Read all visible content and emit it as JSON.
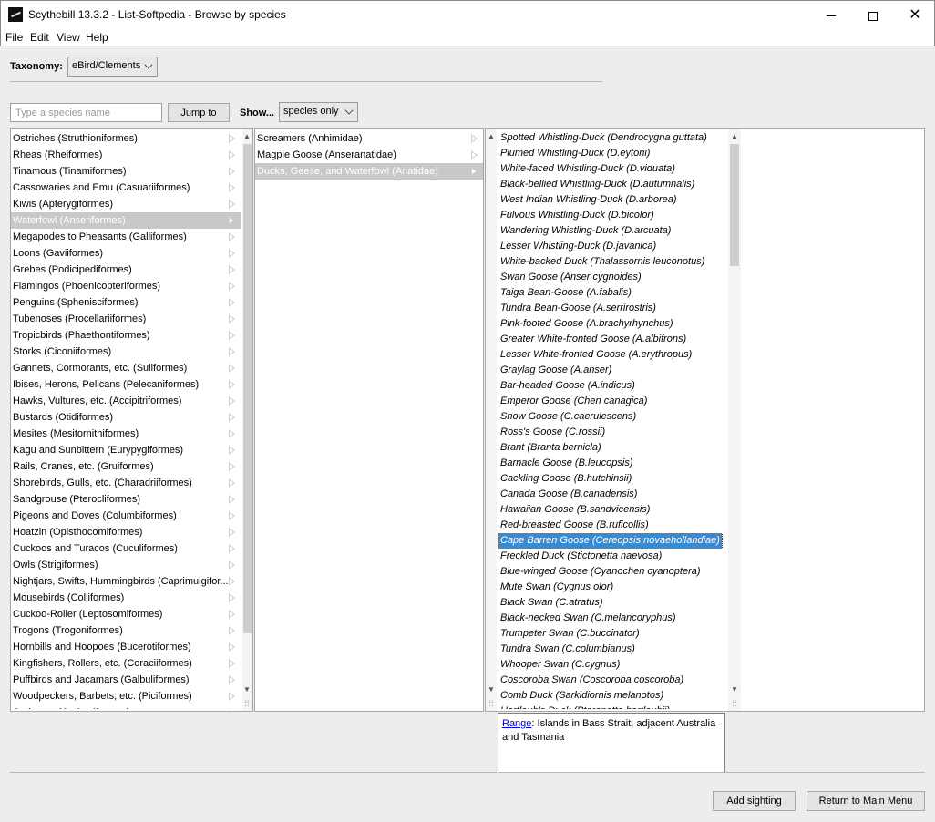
{
  "window": {
    "title": "Scythebill 13.3.2 - List-Softpedia - Browse by species"
  },
  "menu": [
    "File",
    "Edit",
    "View",
    "Help"
  ],
  "taxonomy": {
    "label": "Taxonomy:",
    "value": "eBird/Clements"
  },
  "search": {
    "placeholder": "Type a species name",
    "jump_label": "Jump to"
  },
  "show": {
    "label": "Show...",
    "value": "species only"
  },
  "orders": [
    "Ostriches (Struthioniformes)",
    "Rheas (Rheiformes)",
    "Tinamous (Tinamiformes)",
    "Cassowaries and Emu (Casuariiformes)",
    "Kiwis (Apterygiformes)",
    "Waterfowl (Anseriformes)",
    "Megapodes to Pheasants (Galliformes)",
    "Loons (Gaviiformes)",
    "Grebes (Podicipediformes)",
    "Flamingos (Phoenicopteriformes)",
    "Penguins (Sphenisciformes)",
    "Tubenoses (Procellariiformes)",
    "Tropicbirds (Phaethontiformes)",
    "Storks (Ciconiiformes)",
    "Gannets, Cormorants, etc. (Suliformes)",
    "Ibises, Herons, Pelicans (Pelecaniformes)",
    "Hawks, Vultures, etc. (Accipitriformes)",
    "Bustards (Otidiformes)",
    "Mesites (Mesitornithiformes)",
    "Kagu and Sunbittern (Eurypygiformes)",
    "Rails, Cranes, etc. (Gruiformes)",
    "Shorebirds, Gulls, etc. (Charadriiformes)",
    "Sandgrouse (Pterocliformes)",
    "Pigeons and Doves (Columbiformes)",
    "Hoatzin (Opisthocomiformes)",
    "Cuckoos and Turacos (Cuculiformes)",
    "Owls (Strigiformes)",
    "Nightjars, Swifts, Hummingbirds (Caprimulgifor...",
    "Mousebirds (Coliiformes)",
    "Cuckoo-Roller (Leptosomiformes)",
    "Trogons (Trogoniformes)",
    "Hornbills and Hoopoes (Bucerotiformes)",
    "Kingfishers, Rollers, etc. (Coraciiformes)",
    "Puffbirds and Jacamars (Galbuliformes)",
    "Woodpeckers, Barbets, etc. (Piciformes)",
    "Seriemas (Cariamiformes)"
  ],
  "orders_selected_index": 5,
  "families": [
    "Screamers (Anhimidae)",
    "Magpie Goose (Anseranatidae)",
    "Ducks, Geese, and Waterfowl (Anatidae)"
  ],
  "families_selected_index": 2,
  "species": [
    "Spotted Whistling-Duck (Dendrocygna guttata)",
    "Plumed Whistling-Duck (D.eytoni)",
    "White-faced Whistling-Duck (D.viduata)",
    "Black-bellied Whistling-Duck (D.autumnalis)",
    "West Indian Whistling-Duck (D.arborea)",
    "Fulvous Whistling-Duck (D.bicolor)",
    "Wandering Whistling-Duck (D.arcuata)",
    "Lesser Whistling-Duck (D.javanica)",
    "White-backed Duck (Thalassornis leuconotus)",
    "Swan Goose (Anser cygnoides)",
    "Taiga Bean-Goose (A.fabalis)",
    "Tundra Bean-Goose (A.serrirostris)",
    "Pink-footed Goose (A.brachyrhynchus)",
    "Greater White-fronted Goose (A.albifrons)",
    "Lesser White-fronted Goose (A.erythropus)",
    "Graylag Goose (A.anser)",
    "Bar-headed Goose (A.indicus)",
    "Emperor Goose (Chen canagica)",
    "Snow Goose (C.caerulescens)",
    "Ross's Goose (C.rossii)",
    "Brant (Branta bernicla)",
    "Barnacle Goose (B.leucopsis)",
    "Cackling Goose (B.hutchinsii)",
    "Canada Goose (B.canadensis)",
    "Hawaiian Goose (B.sandvicensis)",
    "Red-breasted Goose (B.ruficollis)",
    "Cape Barren Goose (Cereopsis novaehollandiae)",
    "Freckled Duck (Stictonetta naevosa)",
    "Blue-winged Goose (Cyanochen cyanoptera)",
    "Mute Swan (Cygnus olor)",
    "Black Swan (C.atratus)",
    "Black-necked Swan (C.melancoryphus)",
    "Trumpeter Swan (C.buccinator)",
    "Tundra Swan (C.columbianus)",
    "Whooper Swan (C.cygnus)",
    "Coscoroba Swan (Coscoroba coscoroba)",
    "Comb Duck (Sarkidiornis melanotos)",
    "Hartlaub's Duck (Pteronetta hartlaubii)"
  ],
  "species_selected_index": 26,
  "detail": {
    "link": "Range",
    "text": ": Islands in Bass Strait, adjacent Australia and Tasmania"
  },
  "buttons": {
    "add_sighting": "Add sighting",
    "main_menu": "Return to Main Menu"
  }
}
